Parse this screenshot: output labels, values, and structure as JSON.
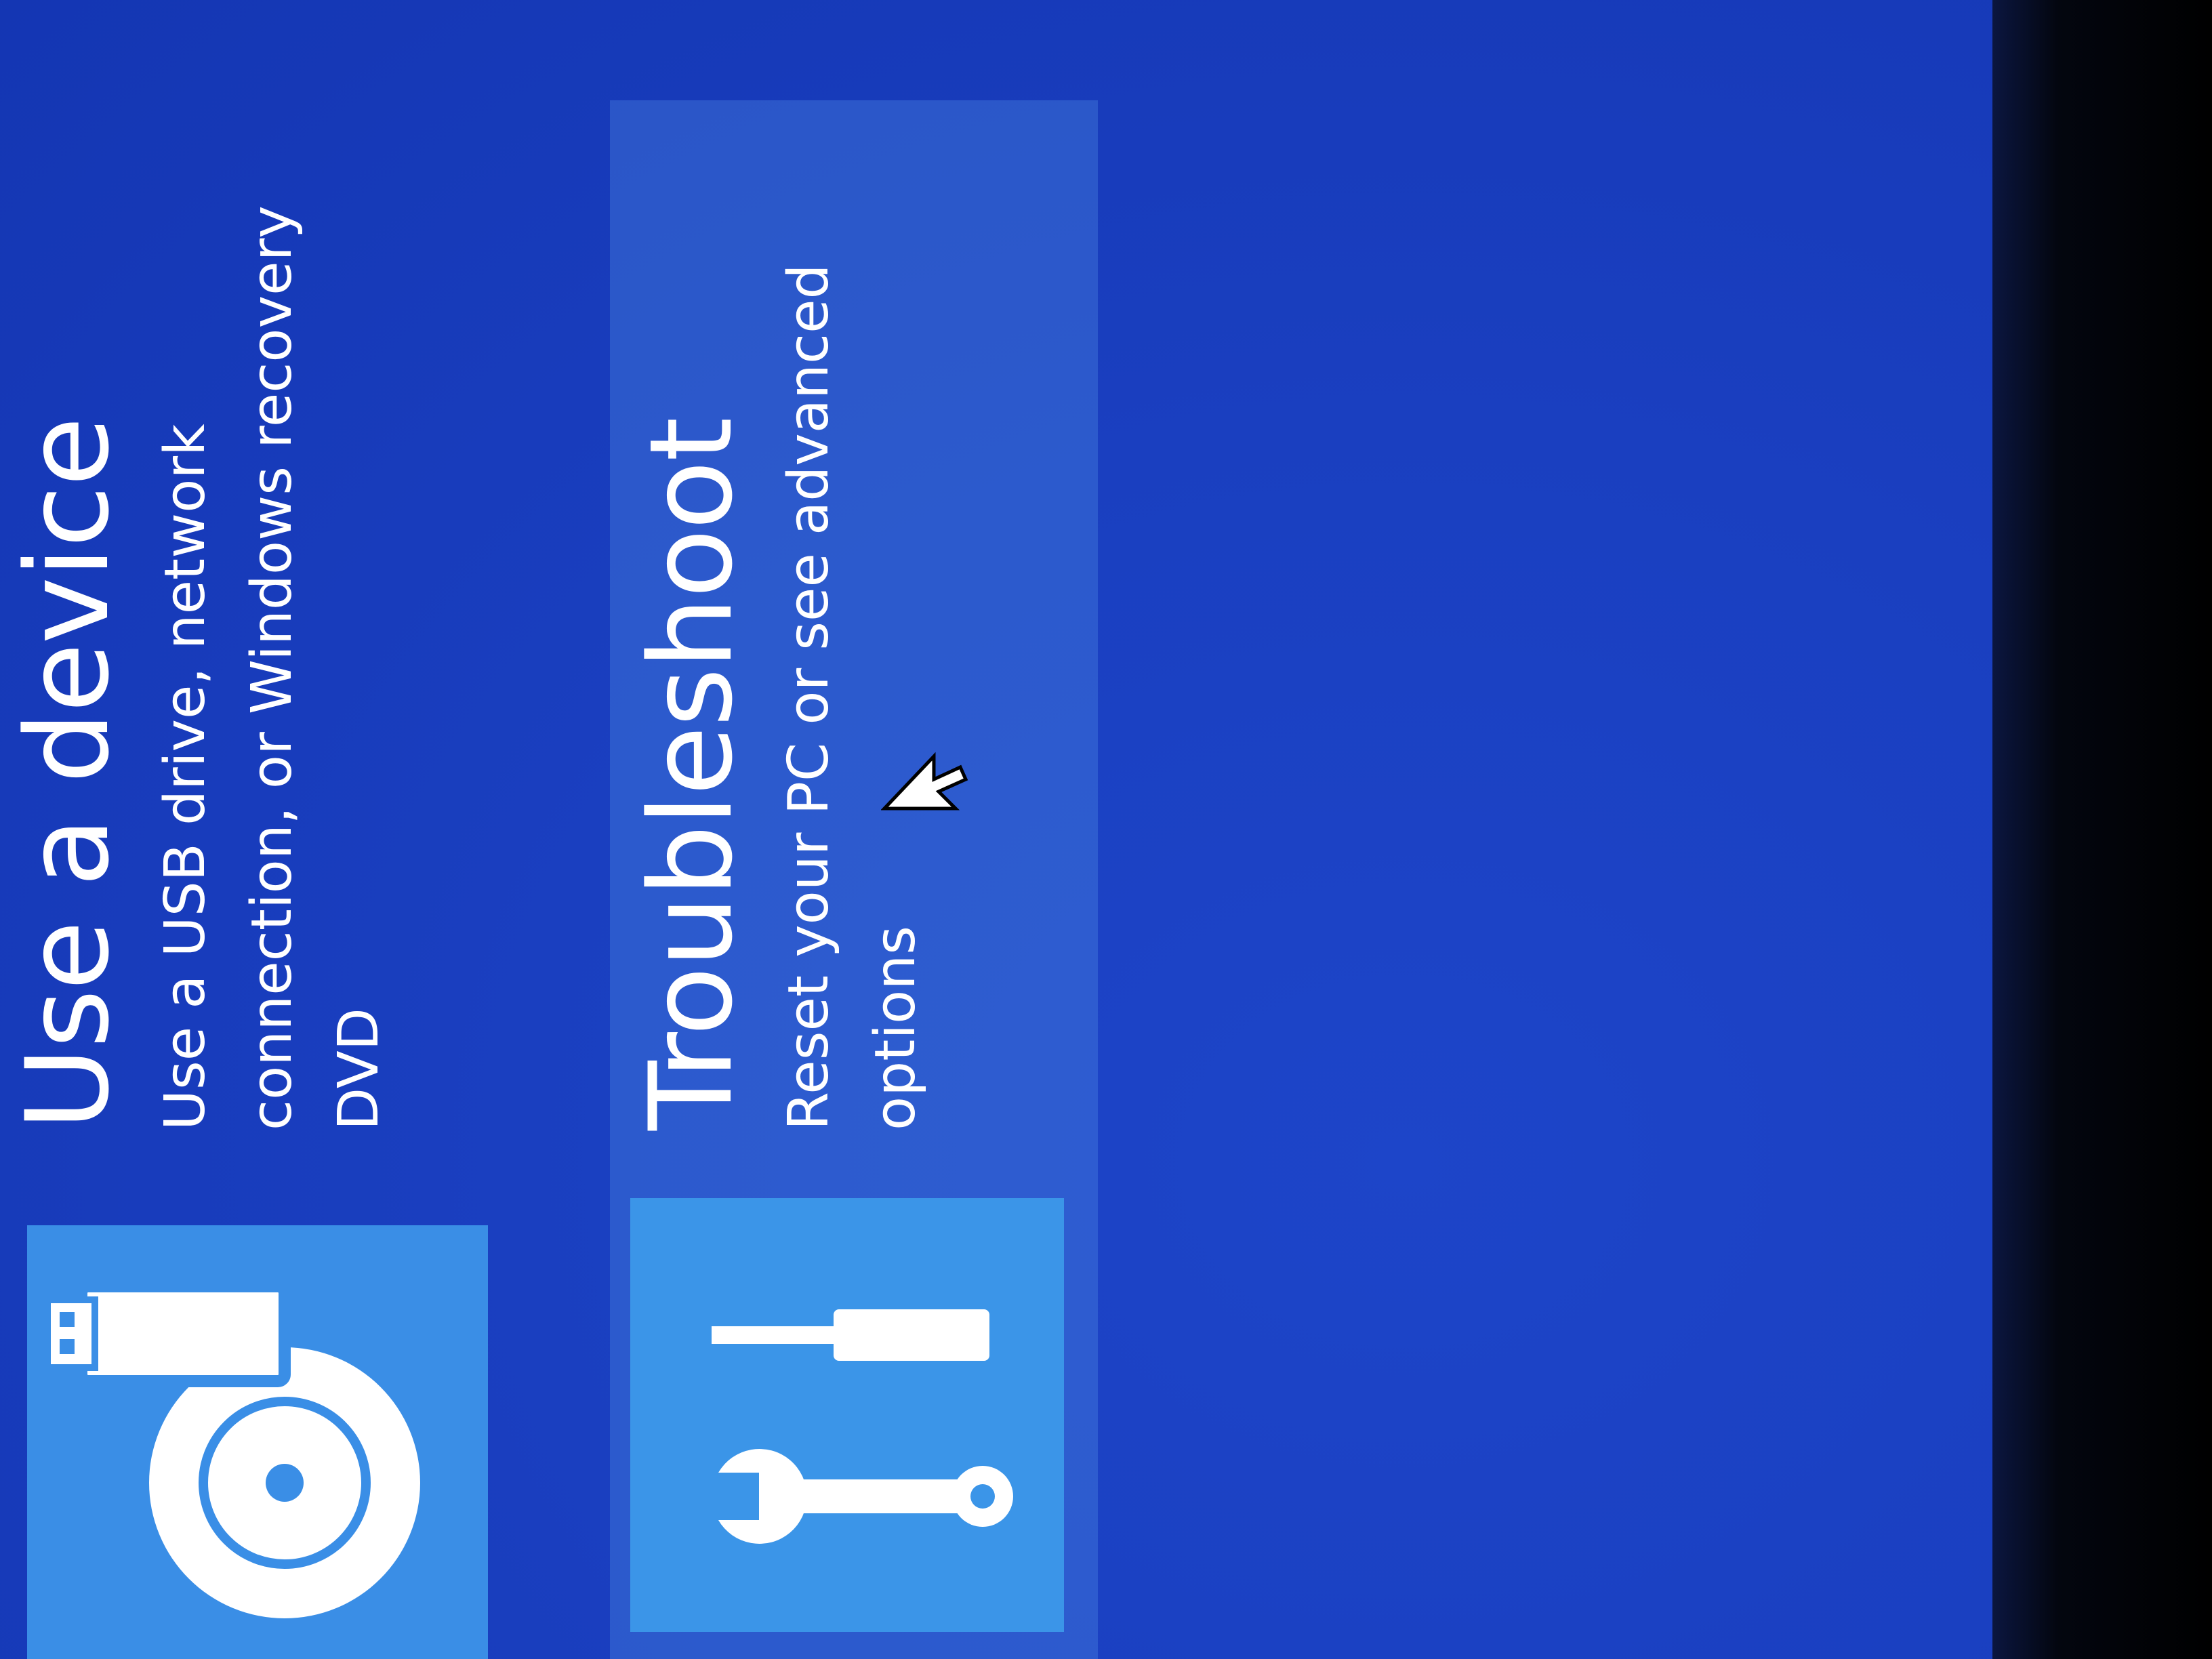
{
  "colors": {
    "background": "#1a3fc0",
    "tile": "#3a8ee6",
    "text": "#ffffff"
  },
  "options": [
    {
      "title": "Use a device",
      "description": "Use a USB drive, network connection, or Windows recovery DVD",
      "icon": "disc-usb-icon"
    },
    {
      "title": "Troubleshoot",
      "description": "Reset your PC or see advanced options",
      "icon": "tools-icon"
    }
  ],
  "cursor": "mouse-pointer-icon"
}
